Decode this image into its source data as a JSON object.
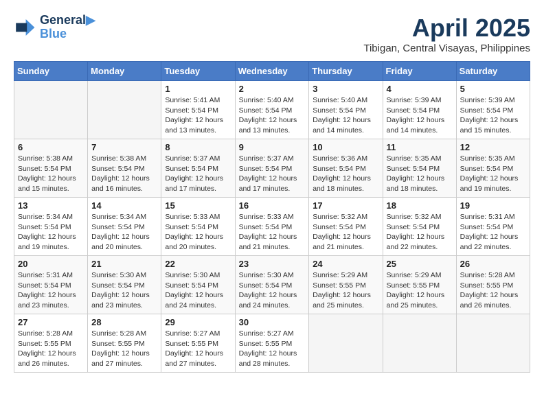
{
  "logo": {
    "line1": "General",
    "line2": "Blue"
  },
  "title": "April 2025",
  "location": "Tibigan, Central Visayas, Philippines",
  "weekdays": [
    "Sunday",
    "Monday",
    "Tuesday",
    "Wednesday",
    "Thursday",
    "Friday",
    "Saturday"
  ],
  "weeks": [
    [
      {
        "day": "",
        "empty": true
      },
      {
        "day": "",
        "empty": true
      },
      {
        "day": "1",
        "sunrise": "5:41 AM",
        "sunset": "5:54 PM",
        "daylight": "12 hours and 13 minutes."
      },
      {
        "day": "2",
        "sunrise": "5:40 AM",
        "sunset": "5:54 PM",
        "daylight": "12 hours and 13 minutes."
      },
      {
        "day": "3",
        "sunrise": "5:40 AM",
        "sunset": "5:54 PM",
        "daylight": "12 hours and 14 minutes."
      },
      {
        "day": "4",
        "sunrise": "5:39 AM",
        "sunset": "5:54 PM",
        "daylight": "12 hours and 14 minutes."
      },
      {
        "day": "5",
        "sunrise": "5:39 AM",
        "sunset": "5:54 PM",
        "daylight": "12 hours and 15 minutes."
      }
    ],
    [
      {
        "day": "6",
        "sunrise": "5:38 AM",
        "sunset": "5:54 PM",
        "daylight": "12 hours and 15 minutes."
      },
      {
        "day": "7",
        "sunrise": "5:38 AM",
        "sunset": "5:54 PM",
        "daylight": "12 hours and 16 minutes."
      },
      {
        "day": "8",
        "sunrise": "5:37 AM",
        "sunset": "5:54 PM",
        "daylight": "12 hours and 17 minutes."
      },
      {
        "day": "9",
        "sunrise": "5:37 AM",
        "sunset": "5:54 PM",
        "daylight": "12 hours and 17 minutes."
      },
      {
        "day": "10",
        "sunrise": "5:36 AM",
        "sunset": "5:54 PM",
        "daylight": "12 hours and 18 minutes."
      },
      {
        "day": "11",
        "sunrise": "5:35 AM",
        "sunset": "5:54 PM",
        "daylight": "12 hours and 18 minutes."
      },
      {
        "day": "12",
        "sunrise": "5:35 AM",
        "sunset": "5:54 PM",
        "daylight": "12 hours and 19 minutes."
      }
    ],
    [
      {
        "day": "13",
        "sunrise": "5:34 AM",
        "sunset": "5:54 PM",
        "daylight": "12 hours and 19 minutes."
      },
      {
        "day": "14",
        "sunrise": "5:34 AM",
        "sunset": "5:54 PM",
        "daylight": "12 hours and 20 minutes."
      },
      {
        "day": "15",
        "sunrise": "5:33 AM",
        "sunset": "5:54 PM",
        "daylight": "12 hours and 20 minutes."
      },
      {
        "day": "16",
        "sunrise": "5:33 AM",
        "sunset": "5:54 PM",
        "daylight": "12 hours and 21 minutes."
      },
      {
        "day": "17",
        "sunrise": "5:32 AM",
        "sunset": "5:54 PM",
        "daylight": "12 hours and 21 minutes."
      },
      {
        "day": "18",
        "sunrise": "5:32 AM",
        "sunset": "5:54 PM",
        "daylight": "12 hours and 22 minutes."
      },
      {
        "day": "19",
        "sunrise": "5:31 AM",
        "sunset": "5:54 PM",
        "daylight": "12 hours and 22 minutes."
      }
    ],
    [
      {
        "day": "20",
        "sunrise": "5:31 AM",
        "sunset": "5:54 PM",
        "daylight": "12 hours and 23 minutes."
      },
      {
        "day": "21",
        "sunrise": "5:30 AM",
        "sunset": "5:54 PM",
        "daylight": "12 hours and 23 minutes."
      },
      {
        "day": "22",
        "sunrise": "5:30 AM",
        "sunset": "5:54 PM",
        "daylight": "12 hours and 24 minutes."
      },
      {
        "day": "23",
        "sunrise": "5:30 AM",
        "sunset": "5:54 PM",
        "daylight": "12 hours and 24 minutes."
      },
      {
        "day": "24",
        "sunrise": "5:29 AM",
        "sunset": "5:55 PM",
        "daylight": "12 hours and 25 minutes."
      },
      {
        "day": "25",
        "sunrise": "5:29 AM",
        "sunset": "5:55 PM",
        "daylight": "12 hours and 25 minutes."
      },
      {
        "day": "26",
        "sunrise": "5:28 AM",
        "sunset": "5:55 PM",
        "daylight": "12 hours and 26 minutes."
      }
    ],
    [
      {
        "day": "27",
        "sunrise": "5:28 AM",
        "sunset": "5:55 PM",
        "daylight": "12 hours and 26 minutes."
      },
      {
        "day": "28",
        "sunrise": "5:28 AM",
        "sunset": "5:55 PM",
        "daylight": "12 hours and 27 minutes."
      },
      {
        "day": "29",
        "sunrise": "5:27 AM",
        "sunset": "5:55 PM",
        "daylight": "12 hours and 27 minutes."
      },
      {
        "day": "30",
        "sunrise": "5:27 AM",
        "sunset": "5:55 PM",
        "daylight": "12 hours and 28 minutes."
      },
      {
        "day": "",
        "empty": true
      },
      {
        "day": "",
        "empty": true
      },
      {
        "day": "",
        "empty": true
      }
    ]
  ]
}
